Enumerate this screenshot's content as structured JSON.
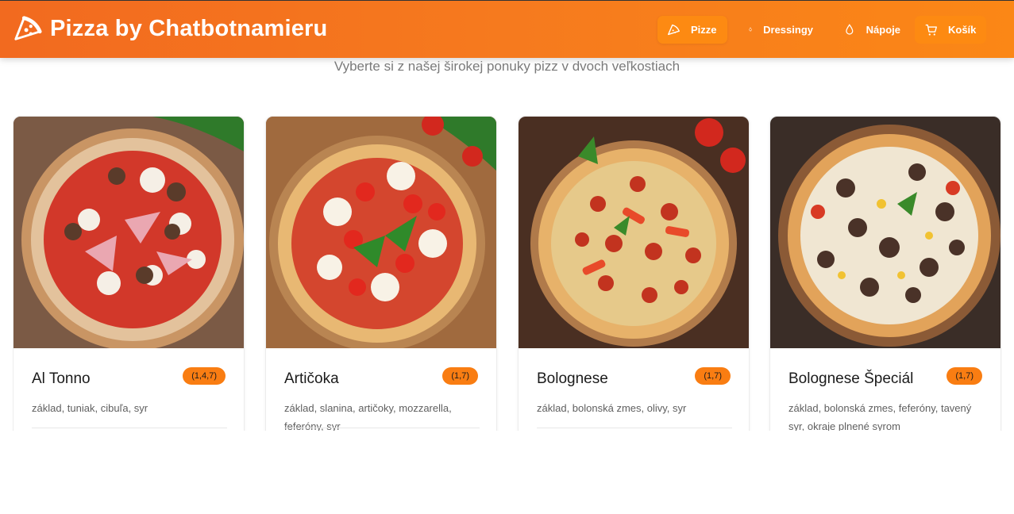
{
  "header": {
    "brand_title": "Pizza by Chatbotnamieru",
    "brand_icon": "pizza-slice-icon",
    "nav": [
      {
        "label": "Pizze",
        "icon": "pizza-slice-icon",
        "active": true
      },
      {
        "label": "Dressingy",
        "icon": "sauce-bottle-icon",
        "active": false
      },
      {
        "label": "Nápoje",
        "icon": "drop-icon",
        "active": false
      },
      {
        "label": "Košík",
        "icon": "cart-icon",
        "active": false
      }
    ]
  },
  "subtitle": "Vyberte si z našej širokej ponuky pizz v dvoch veľkostiach",
  "pizzas": [
    {
      "name": "Al Tonno",
      "allergens": "(1,4,7)",
      "description": "základ, tuniak, cibuľa, syr",
      "image": "pizza-image"
    },
    {
      "name": "Artičoka",
      "allergens": "(1,7)",
      "description": "základ, slanina, artičoky, mozzarella, feferóny, syr",
      "image": "pizza-image"
    },
    {
      "name": "Bolognese",
      "allergens": "(1,7)",
      "description": "základ, bolonská zmes, olivy, syr",
      "image": "pizza-image"
    },
    {
      "name": "Bolognese Špeciál",
      "allergens": "(1,7)",
      "description": "základ, bolonská zmes, feferóny, tavený syr, okraje plnené syrom",
      "image": "pizza-image"
    }
  ],
  "colors": {
    "header_start": "#f26a1f",
    "header_end": "#fb8716",
    "accent": "#f97d12"
  }
}
